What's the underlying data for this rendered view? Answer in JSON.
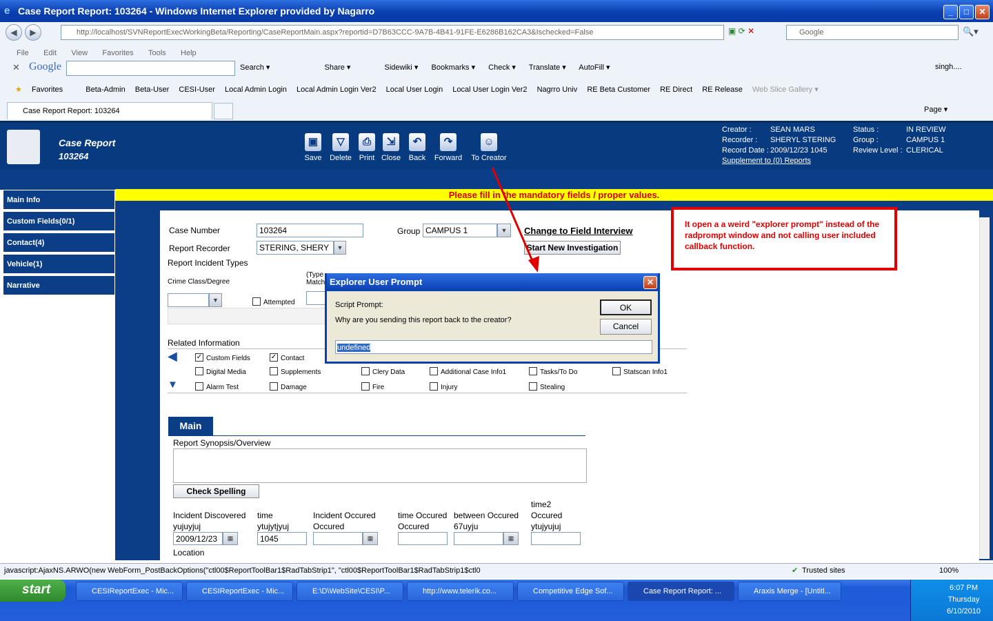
{
  "window": {
    "title": "Case Report Report: 103264 - Windows Internet Explorer provided by Nagarro",
    "min": "_",
    "max": "□",
    "close": "✕"
  },
  "address": {
    "url": "http://localhost/SVNReportExecWorkingBeta/Reporting/CaseReportMain.aspx?reportid=D7B63CCC-9A7B-4B41-91FE-E6286B162CA3&Ischecked=False",
    "search_placeholder": "Google"
  },
  "menu": [
    "File",
    "Edit",
    "View",
    "Favorites",
    "Tools",
    "Help"
  ],
  "google_toolbar": {
    "brand": "Google",
    "items": [
      "Search ▾",
      "Share ▾",
      "Sidewiki ▾",
      "Bookmarks ▾",
      "Check ▾",
      "Translate ▾",
      "AutoFill ▾"
    ],
    "user": "singh...."
  },
  "favorites": {
    "label": "Favorites",
    "items": [
      "Beta-Admin",
      "Beta-User",
      "CESI-User",
      "Local Admin Login",
      "Local Admin Login Ver2",
      "Local User Login",
      "Local User Login Ver2",
      "Nagrro Univ",
      "RE Beta Customer",
      "RE Direct",
      "RE Release",
      "Web Slice Gallery ▾"
    ]
  },
  "tab": {
    "title": "Case Report Report: 103264",
    "page_menu": "Page ▾"
  },
  "header": {
    "title": "Case Report",
    "number": "103264",
    "buttons": [
      "Save",
      "Delete",
      "Print",
      "Close",
      "Back",
      "Forward",
      "To Creator"
    ],
    "meta": {
      "creator_label": "Creator :",
      "creator": "SEAN MARS",
      "recorder_label": "Recorder :",
      "recorder": "SHERYL STERING",
      "record_date_label": "Record Date :",
      "record_date": "2009/12/23 1045",
      "supplement_link": "Supplement to (0) Reports",
      "status_label": "Status :",
      "status": "IN REVIEW",
      "group_label": "Group :",
      "group": "CAMPUS 1",
      "review_label": "Review Level :",
      "review": "CLERICAL"
    }
  },
  "sidebar": [
    "Main Info",
    "Custom Fields(0/1)",
    "Contact(4)",
    "Vehicle(1)",
    "Narrative"
  ],
  "warning": "Please fill in the mandatory fields / proper values.",
  "form": {
    "case_number_label": "Case Number",
    "case_number": "103264",
    "group_label": "Group",
    "group": "CAMPUS 1",
    "change_link": "Change to Field Interview",
    "recorder_label": "Report Recorder",
    "recorder": "STERING, SHERY",
    "start_btn": "Start New Investigation",
    "incident_types_label": "Report Incident Types",
    "crime_class_label": "Crime Class/Degree",
    "attempted_label": "Attempted",
    "type_label": "(Type",
    "match_label": "Match",
    "related_label": "Related Information",
    "checks": [
      [
        "Custom Fields",
        "Contact"
      ],
      [
        "Digital Media",
        "Supplements",
        "Clery Data",
        "Additional Case Info1",
        "Tasks/To Do",
        "Statscan Info1"
      ],
      [
        "Alarm Test",
        "Damage",
        "Fire",
        "Injury",
        "Stealing"
      ]
    ],
    "main_tab": "Main",
    "synopsis_label": "Report Synopsis/Overview",
    "spelling_btn": "Check Spelling",
    "incident_discovered_label": "Incident Discovered yujuyjuj",
    "incident_discovered": "2009/12/23",
    "time_label": "time ytujytjyuj",
    "time": "1045",
    "incident_occured_label": "Incident Occured Occured",
    "time_occured_label": "time Occured Occured",
    "between_label": "between Occured 67uyju",
    "time2_label": "time2 Occured ytujyujuj",
    "location_label": "Location"
  },
  "dialog": {
    "title": "Explorer User Prompt",
    "script_prompt": "Script Prompt:",
    "question": "Why are you sending this report back to the creator?",
    "ok": "OK",
    "cancel": "Cancel",
    "value": "undefined"
  },
  "annotation": "It open a a weird \"explorer prompt\" instead of the radprompt window and not calling user included callback function.",
  "status": {
    "text": "javascript:AjaxNS.ARWO(new WebForm_PostBackOptions(\"ctl00$ReportToolBar1$RadTabStrip1\", \"ctl00$ReportToolBar1$RadTabStrip1$ctl0",
    "zone": "Trusted sites",
    "zoom": "100%"
  },
  "taskbar": {
    "start": "start",
    "items": [
      "CESIReportExec - Mic...",
      "CESIReportExec - Mic...",
      "E:\\D\\WebSite\\CESI\\P...",
      "http://www.telerik.co...",
      "Competitive Edge Sof...",
      "Case Report Report: ...",
      "Araxis Merge - [Untitl..."
    ],
    "time": "6:07 PM",
    "day": "Thursday",
    "date": "6/10/2010"
  }
}
